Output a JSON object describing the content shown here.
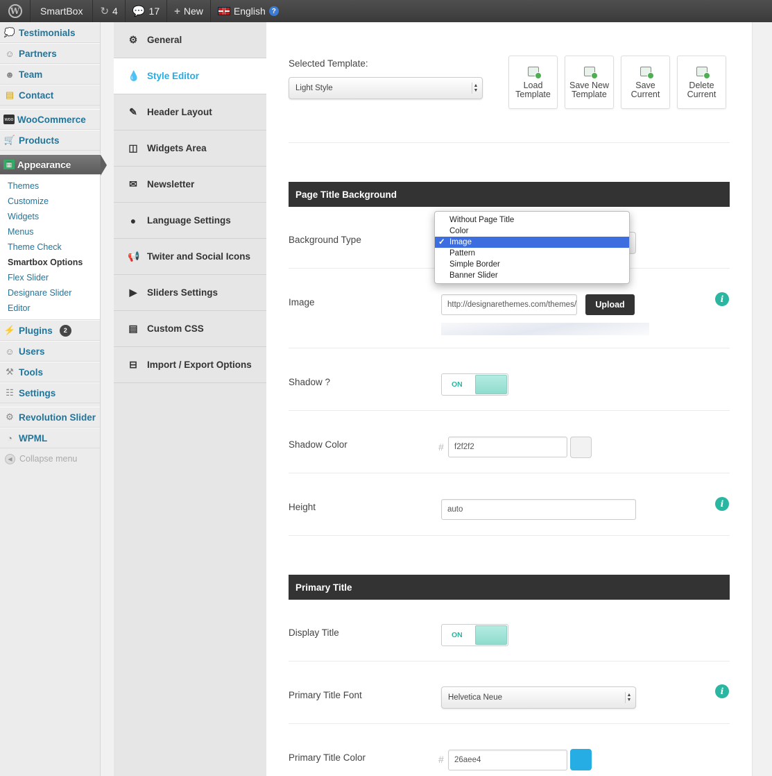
{
  "adminbar": {
    "site": "SmartBox",
    "updates": "4",
    "comments": "17",
    "new": "New",
    "language": "English"
  },
  "admin_menu": {
    "top_items": [
      {
        "label": "Testimonials",
        "icon": "chat-bubbles-icon"
      },
      {
        "label": "Partners",
        "icon": "user-icon"
      },
      {
        "label": "Team",
        "icon": "team-icon"
      },
      {
        "label": "Contact",
        "icon": "contact-icon"
      }
    ],
    "woo_items": [
      {
        "label": "WooCommerce",
        "icon": "woocommerce-icon"
      },
      {
        "label": "Products",
        "icon": "cart-icon"
      }
    ],
    "appearance": "Appearance",
    "submenu": [
      "Themes",
      "Customize",
      "Widgets",
      "Menus",
      "Theme Check",
      "Smartbox Options",
      "Flex Slider",
      "Designare Slider",
      "Editor"
    ],
    "plugins": "Plugins",
    "plugins_badge": "2",
    "users": "Users",
    "tools": "Tools",
    "settings": "Settings",
    "revolution": "Revolution Slider",
    "wpml": "WPML",
    "collapse": "Collapse menu"
  },
  "options_nav": [
    {
      "label": "General",
      "icon": "gears-icon"
    },
    {
      "label": "Style Editor",
      "icon": "droplet-icon"
    },
    {
      "label": "Header Layout",
      "icon": "edit-icon"
    },
    {
      "label": "Widgets Area",
      "icon": "columns-icon"
    },
    {
      "label": "Newsletter",
      "icon": "envelope-icon"
    },
    {
      "label": "Language Settings",
      "icon": "globe-icon"
    },
    {
      "label": "Twiter and Social Icons",
      "icon": "bullhorn-icon"
    },
    {
      "label": "Sliders Settings",
      "icon": "play-circle-icon"
    },
    {
      "label": "Custom CSS",
      "icon": "file-icon"
    },
    {
      "label": "Import / Export Options",
      "icon": "drive-icon"
    }
  ],
  "template": {
    "label": "Selected Template:",
    "value": "Light Style",
    "buttons": [
      {
        "line1": "Load",
        "line2": "Template"
      },
      {
        "line1": "Save New",
        "line2": "Template"
      },
      {
        "line1": "Save",
        "line2": "Current"
      },
      {
        "line1": "Delete",
        "line2": "Current"
      }
    ]
  },
  "page_title_bg": {
    "heading": "Page Title Background",
    "background_type_label": "Background Type",
    "background_type_options": [
      "Without Page Title",
      "Color",
      "Image",
      "Pattern",
      "Simple Border",
      "Banner Slider"
    ],
    "background_type_selected": "Image",
    "checkmark": "✓",
    "image_label": "Image",
    "image_value": "http://designarethemes.com/themes/s",
    "upload_label": "Upload",
    "shadow_label": "Shadow ?",
    "shadow_state": "ON",
    "shadow_color_label": "Shadow Color",
    "shadow_color_value": "f2f2f2",
    "shadow_color_hex": "#f2f2f2",
    "height_label": "Height",
    "height_value": "auto"
  },
  "primary_title": {
    "heading": "Primary Title",
    "display_label": "Display Title",
    "display_state": "ON",
    "font_label": "Primary Title Font",
    "font_value": "Helvetica Neue",
    "color_label": "Primary Title Color",
    "color_value": "26aee4",
    "color_hex": "#26aee4"
  },
  "hash_symbol": "#",
  "info_glyph": "i",
  "accent_color": "#26aee4"
}
